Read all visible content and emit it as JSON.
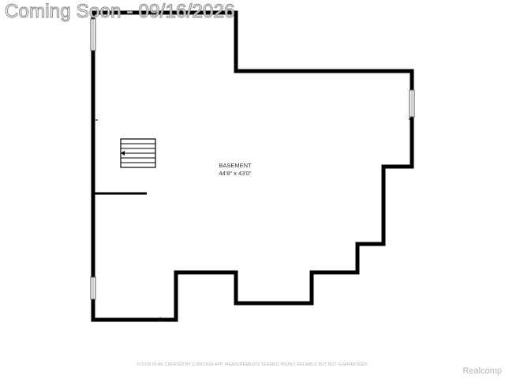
{
  "watermark": {
    "text": "Coming Soon - 09/16/2026"
  },
  "room": {
    "name": "BASEMENT",
    "dimensions": "44'8\" x 43'0\""
  },
  "footer": {
    "disclaimer": "FLOOR PLAN CREATED BY CUBICASA APP. MEASUREMENTS DEEMED HIGHLY RELIABLE BUT NOT GUARANTEED.",
    "brand": "Realcomp"
  },
  "colors": {
    "wall": "#000000",
    "background": "#ffffff",
    "window": "#cfd8dc"
  },
  "icons": {
    "stairs": "stairs-icon",
    "window": "window-icon"
  }
}
